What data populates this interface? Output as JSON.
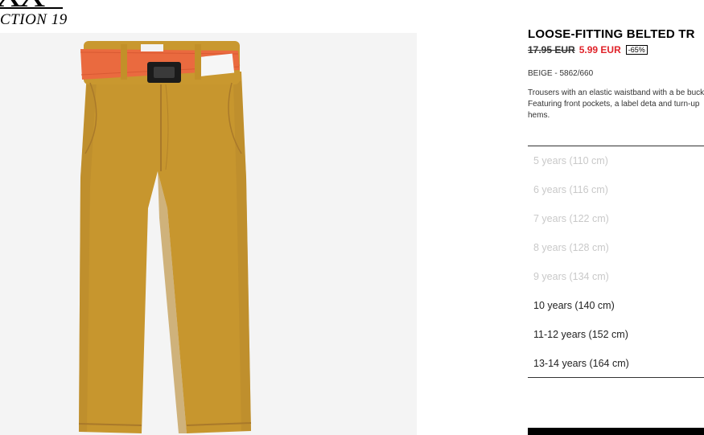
{
  "header": {
    "logo_text": "XX",
    "collection_label": "CTION 19"
  },
  "product": {
    "title": "LOOSE-FITTING BELTED TR",
    "old_price": "17.95 EUR",
    "new_price": "5.99 EUR",
    "discount": "-65%",
    "color_ref": "BEIGE - 5862/660",
    "description": "Trousers with an elastic waistband with a be buckle. Featuring front pockets, a label deta and turn-up hems.",
    "image": {
      "alt_icon": "trousers-image",
      "colors": {
        "fabric": "#c7962e",
        "belt": "#ea6a3f",
        "buckle": "#1b1b1b",
        "background": "#f4f4f4"
      }
    }
  },
  "sizes": [
    {
      "label": "5 years (110 cm)",
      "available": false
    },
    {
      "label": "6 years (116 cm)",
      "available": false
    },
    {
      "label": "7 years (122 cm)",
      "available": false
    },
    {
      "label": "8 years (128 cm)",
      "available": false
    },
    {
      "label": "9 years (134 cm)",
      "available": false
    },
    {
      "label": "10 years (140 cm)",
      "available": true
    },
    {
      "label": "11-12 years (152 cm)",
      "available": true
    },
    {
      "label": "13-14 years (164 cm)",
      "available": true
    }
  ],
  "colors": {
    "sale_red": "#e0232a",
    "unavailable_gray": "#c9c9c9",
    "text": "#222222"
  }
}
